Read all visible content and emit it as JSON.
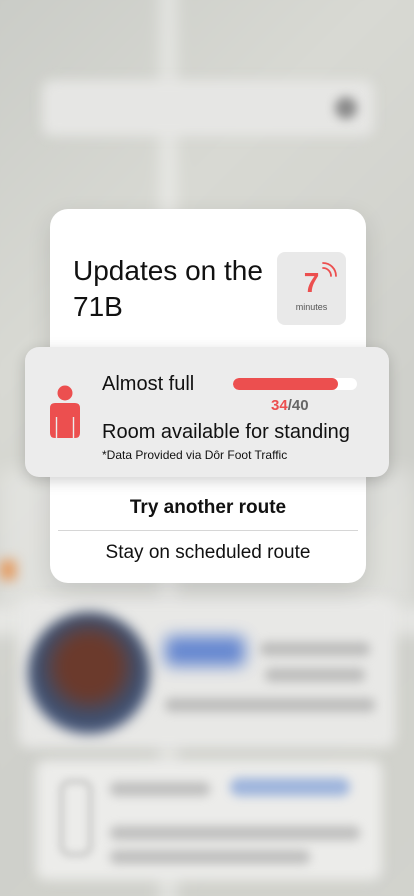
{
  "modal": {
    "title": "Updates on the 71B",
    "eta": {
      "value": "7",
      "unit": "minutes"
    },
    "primary_action": "Try another route",
    "secondary_action": "Stay on scheduled route"
  },
  "occupancy": {
    "status": "Almost full",
    "current": "34",
    "separator": "/",
    "capacity": "40",
    "fill_fraction": 0.85,
    "description": "Room available for standing",
    "note": "*Data Provided via Dôr Foot Traffic"
  },
  "colors": {
    "accent": "#ec4f4f",
    "card_bg": "#ececec",
    "modal_bg": "#ffffff"
  },
  "icons": {
    "person": "person-icon",
    "signal": "live-signal-icon"
  }
}
